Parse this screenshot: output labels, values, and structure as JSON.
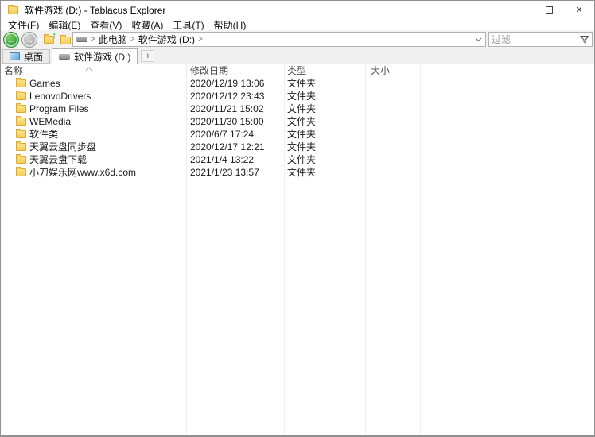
{
  "window": {
    "title": "软件游戏 (D:) - Tablacus Explorer"
  },
  "menubar": {
    "items": [
      {
        "label": "文件(F)"
      },
      {
        "label": "编辑(E)"
      },
      {
        "label": "查看(V)"
      },
      {
        "label": "收藏(A)"
      },
      {
        "label": "工具(T)"
      },
      {
        "label": "帮助(H)"
      }
    ]
  },
  "toolbar": {
    "breadcrumb": {
      "separator": ">",
      "segments": [
        "此电脑",
        "软件游戏 (D:)"
      ]
    },
    "filter_placeholder": "过滤"
  },
  "tabbar": {
    "tabs": [
      {
        "label": "桌面",
        "active": false
      },
      {
        "label": "软件游戏 (D:)",
        "active": true
      }
    ],
    "new_tab_label": "+"
  },
  "list": {
    "columns": [
      "名称",
      "修改日期",
      "类型",
      "大小"
    ],
    "sort_column": "名称",
    "sort_direction": "ascending",
    "rows": [
      {
        "name": "Games",
        "modified": "2020/12/19 13:06",
        "type": "文件夹",
        "size": ""
      },
      {
        "name": "LenovoDrivers",
        "modified": "2020/12/12 23:43",
        "type": "文件夹",
        "size": ""
      },
      {
        "name": "Program Files",
        "modified": "2020/11/21 15:02",
        "type": "文件夹",
        "size": ""
      },
      {
        "name": "WEMedia",
        "modified": "2020/11/30 15:00",
        "type": "文件夹",
        "size": ""
      },
      {
        "name": "软件类",
        "modified": "2020/6/7 17:24",
        "type": "文件夹",
        "size": ""
      },
      {
        "name": "天翼云盘同步盘",
        "modified": "2020/12/17 12:21",
        "type": "文件夹",
        "size": ""
      },
      {
        "name": "天翼云盘下载",
        "modified": "2021/1/4 13:22",
        "type": "文件夹",
        "size": ""
      },
      {
        "name": "小刀娱乐网www.x6d.com",
        "modified": "2021/1/23 13:57",
        "type": "文件夹",
        "size": ""
      }
    ]
  },
  "icons": {
    "back": "←",
    "forward": "→",
    "up": "↑",
    "add": "+",
    "close": "✕"
  },
  "colors": {
    "back_button_green": "#2f9e35",
    "folder_yellow": "#f3cd5d",
    "tab_screen_blue": "#58a6dd",
    "column_line": "#e9eef7"
  }
}
